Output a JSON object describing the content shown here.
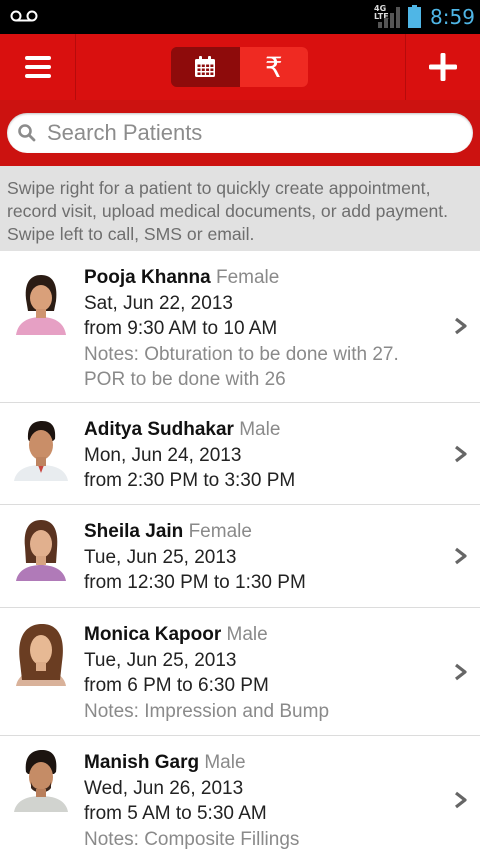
{
  "status_bar": {
    "network_label_top": "4G",
    "network_label_bottom": "LTE",
    "time": "8:59"
  },
  "action_bar": {
    "menu_icon": "hamburger-menu-icon",
    "calendar_icon": "calendar-icon",
    "payment_symbol": "₹",
    "add_icon": "plus-icon",
    "colors": {
      "bar": "#d9100f",
      "selected_segment": "#8e0b0b",
      "unselected_segment": "#ef2a22"
    }
  },
  "search": {
    "placeholder": "Search Patients",
    "value": ""
  },
  "hint": {
    "text": "Swipe right for a patient to quickly create appointment, record visit, upload medical documents, or add payment. Swipe left to call, SMS or email."
  },
  "patients": [
    {
      "name": "Pooja Khanna",
      "gender": "Female",
      "date": "Sat, Jun 22, 2013",
      "time": "from 9:30 AM to 10 AM",
      "notes_line1": "Notes: Obturation to be done with 27.",
      "notes_line2": "POR to be done with 26"
    },
    {
      "name": "Aditya Sudhakar",
      "gender": "Male",
      "date": "Mon, Jun 24, 2013",
      "time": "from 2:30 PM to 3:30 PM"
    },
    {
      "name": "Sheila Jain",
      "gender": "Female",
      "date": "Tue, Jun 25, 2013",
      "time": "from 12:30 PM to 1:30 PM"
    },
    {
      "name": "Monica Kapoor",
      "gender": "Male",
      "date": "Tue, Jun 25, 2013",
      "time": "from 6 PM to 6:30 PM",
      "notes_line1": "Notes: Impression and Bump"
    },
    {
      "name": "Manish Garg",
      "gender": "Male",
      "date": "Wed, Jun 26, 2013",
      "time": "from 5 AM to 5:30 AM",
      "notes_line1": "Notes: Composite Fillings"
    }
  ]
}
